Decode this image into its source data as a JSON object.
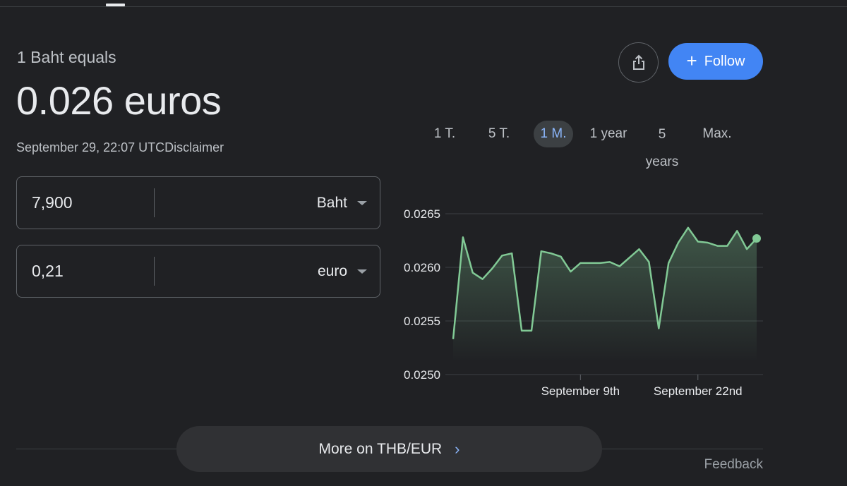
{
  "header": {
    "equals_label": "1 Baht equals",
    "rate_value": "0.026 euros",
    "timestamp": "September 29, 22:07 UTC",
    "disclaimer": "Disclaimer"
  },
  "converter": {
    "from": {
      "value": "7,900",
      "currency": "Baht"
    },
    "to": {
      "value": "0,21",
      "currency": "euro"
    }
  },
  "actions": {
    "share_icon": "share-icon",
    "follow_label": "Follow"
  },
  "range_tabs": [
    {
      "label": "1 T."
    },
    {
      "label": "5 T."
    },
    {
      "label": "1 M.",
      "active": true
    },
    {
      "label": "1 year"
    },
    {
      "label": "5 years"
    },
    {
      "label": "Max."
    }
  ],
  "chart_data": {
    "type": "area",
    "y_ticks": [
      "0.0265",
      "0.0260",
      "0.0255",
      "0.0250"
    ],
    "ylim": [
      0.025,
      0.0265
    ],
    "x_tick_labels": [
      {
        "label": "September 9th",
        "index": 13
      },
      {
        "label": "September 22nd",
        "index": 25
      }
    ],
    "values": [
      0.02533,
      0.02628,
      0.02595,
      0.02589,
      0.02599,
      0.02611,
      0.02613,
      0.02541,
      0.02541,
      0.02615,
      0.02613,
      0.0261,
      0.02596,
      0.02604,
      0.02604,
      0.02604,
      0.02605,
      0.02601,
      0.02609,
      0.02617,
      0.02605,
      0.02543,
      0.02604,
      0.02623,
      0.02637,
      0.02624,
      0.02623,
      0.0262,
      0.0262,
      0.02634,
      0.02617,
      0.02627
    ],
    "line_color": "#81c995",
    "grid": true
  },
  "footer": {
    "more_label": "More on THB/EUR",
    "feedback": "Feedback"
  }
}
